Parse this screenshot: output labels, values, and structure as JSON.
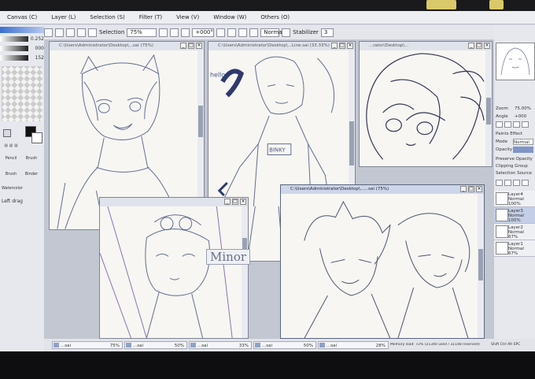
{
  "menu": [
    "Canvas (C)",
    "Layer (L)",
    "Selection (S)",
    "Filter (T)",
    "View (V)",
    "Window (W)",
    "Others (O)"
  ],
  "toolbar": {
    "selection_label": "Selection",
    "zoom_value": "75%",
    "angle_value": "+000°",
    "blend_mode": "Normal",
    "stabilizer_label": "Stabilizer",
    "stabilizer_value": "3"
  },
  "left_panel": {
    "values": [
      "0.252",
      "000",
      "152"
    ],
    "tools": [
      "Pencil",
      "Brush",
      "Brush",
      "Binder",
      "Watercolor"
    ],
    "hint": "Left drag"
  },
  "windows": [
    {
      "title": "C:\\Users\\Administrator\\Desktop\\...sai (75%)"
    },
    {
      "title": "C:\\Users\\Administrator\\Desktop\\...Line.sai (33.33%)"
    },
    {
      "title": "...rator\\Desktop\\..."
    },
    {
      "title": ""
    },
    {
      "title": "C:\\Users\\Administrator\\Desktop\\......sai (75%)"
    }
  ],
  "sketch_text": {
    "hello": "hello",
    "shirt": "BINKY",
    "signature": "Minor"
  },
  "right_panel": {
    "zoom_label": "Zoom",
    "zoom_value": "75.00%",
    "angle_label": "Angle",
    "angle_value": "+000",
    "effect_label": "Paints Effect",
    "mode_label": "Mode",
    "mode_value": "Normal",
    "opacity_label": "Opacity",
    "options": [
      "Preserve Opacity",
      "Clipping Group",
      "Selection Source"
    ],
    "layers": [
      {
        "name": "Layer4",
        "mode": "Normal",
        "opacity": "100%"
      },
      {
        "name": "Layer3",
        "mode": "Normal",
        "opacity": "100%"
      },
      {
        "name": "Layer2",
        "mode": "Normal",
        "opacity": "67%"
      },
      {
        "name": "Layer1",
        "mode": "Normal",
        "opacity": "67%"
      }
    ]
  },
  "statusbar": {
    "tabs": [
      {
        "name": "...sai",
        "zoom": "75%"
      },
      {
        "name": "...sai",
        "zoom": "50%"
      },
      {
        "name": "...sai",
        "zoom": "33%"
      },
      {
        "name": "...sai",
        "zoom": "50%"
      },
      {
        "name": "...sai",
        "zoom": "28%"
      }
    ],
    "memory": "Memory load: 72% (21340 used / 31148 reserved)",
    "keys": "Shift Ctrl Alt SPC"
  },
  "colors": {
    "accent": "#cdd6ea",
    "canvas_bg": "#c3c7d2",
    "line_art": "#5f6b94"
  }
}
